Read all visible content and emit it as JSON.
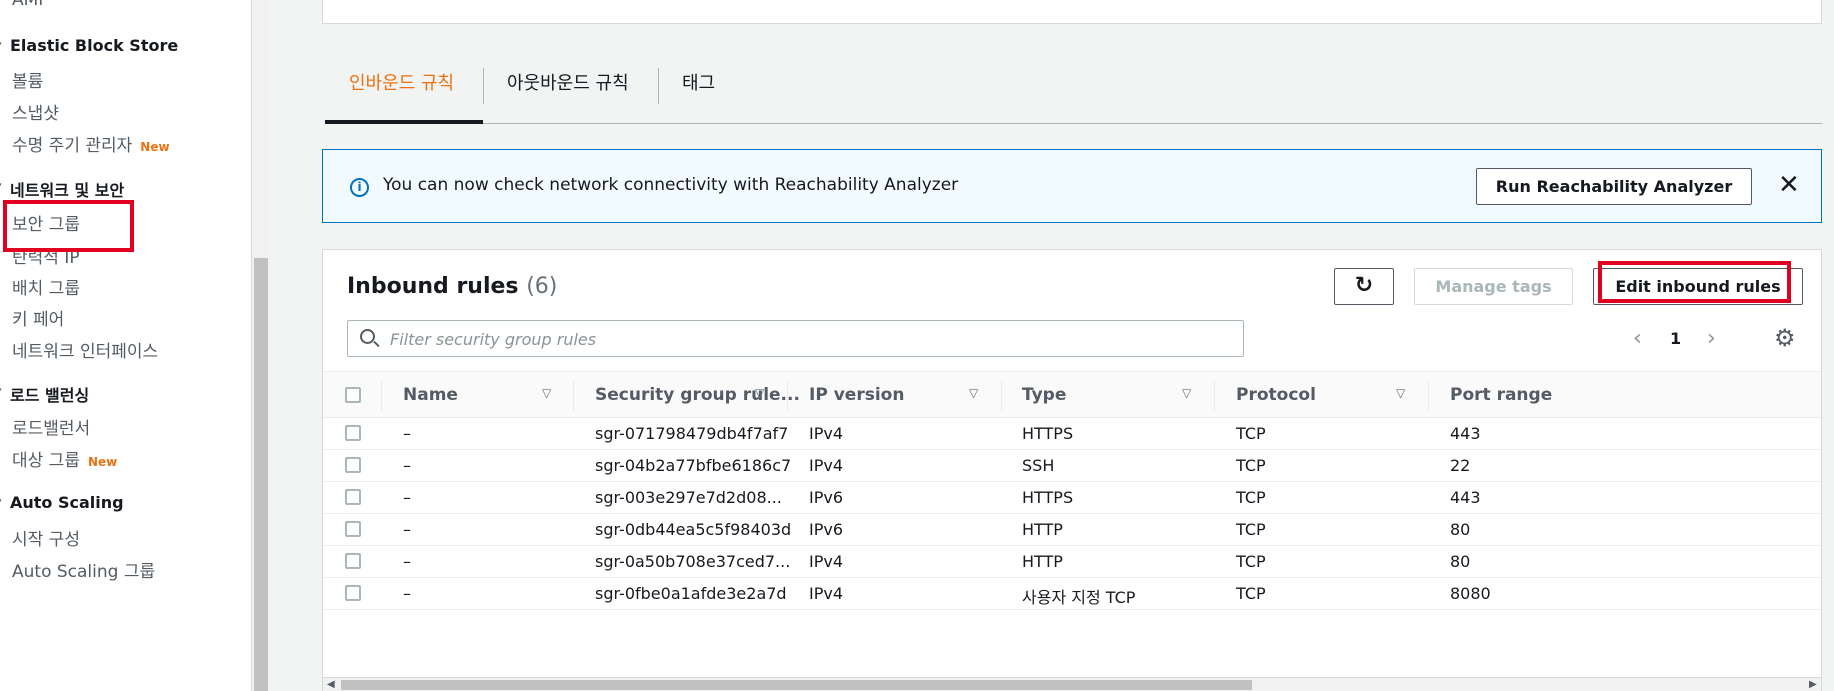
{
  "sidebar": {
    "cut_item": "AMI",
    "groups": [
      {
        "title": "Elastic Block Store",
        "items": [
          {
            "label": "볼륨"
          },
          {
            "label": "스냅샷"
          },
          {
            "label": "수명 주기 관리자",
            "badge": "New"
          }
        ]
      },
      {
        "title": "네트워크 및 보안",
        "items": [
          {
            "label": "보안 그룹"
          },
          {
            "label": "탄력적 IP"
          },
          {
            "label": "배치 그룹"
          },
          {
            "label": "키 페어"
          },
          {
            "label": "네트워크 인터페이스"
          }
        ]
      },
      {
        "title": "로드 밸런싱",
        "items": [
          {
            "label": "로드밸런서"
          },
          {
            "label": "대상 그룹",
            "badge": "New"
          }
        ]
      },
      {
        "title": "Auto Scaling",
        "items": [
          {
            "label": "시작 구성"
          },
          {
            "label": "Auto Scaling 그룹"
          }
        ]
      }
    ]
  },
  "tabs": [
    {
      "label": "인바운드 규칙",
      "active": true
    },
    {
      "label": "아웃바운드 규칙",
      "active": false
    },
    {
      "label": "태그",
      "active": false
    }
  ],
  "info_banner": {
    "message": "You can now check network connectivity with Reachability Analyzer",
    "button_label": "Run Reachability Analyzer",
    "close_icon": "✕"
  },
  "inbound": {
    "title": "Inbound rules",
    "count": "(6)",
    "refresh_icon": "↻",
    "manage_tags_label": "Manage tags",
    "edit_label": "Edit inbound rules",
    "search_placeholder": "Filter security group rules",
    "page": "1",
    "columns": [
      "Name",
      "Security group rule...",
      "IP version",
      "Type",
      "Protocol",
      "Port range"
    ],
    "rows": [
      {
        "name": "–",
        "rule_id": "sgr-071798479db4f7af7",
        "ip_version": "IPv4",
        "type": "HTTPS",
        "protocol": "TCP",
        "port_range": "443"
      },
      {
        "name": "–",
        "rule_id": "sgr-04b2a77bfbe6186c7",
        "ip_version": "IPv4",
        "type": "SSH",
        "protocol": "TCP",
        "port_range": "22"
      },
      {
        "name": "–",
        "rule_id": "sgr-003e297e7d2d08...",
        "ip_version": "IPv6",
        "type": "HTTPS",
        "protocol": "TCP",
        "port_range": "443"
      },
      {
        "name": "–",
        "rule_id": "sgr-0db44ea5c5f98403d",
        "ip_version": "IPv6",
        "type": "HTTP",
        "protocol": "TCP",
        "port_range": "80"
      },
      {
        "name": "–",
        "rule_id": "sgr-0a50b708e37ced7...",
        "ip_version": "IPv4",
        "type": "HTTP",
        "protocol": "TCP",
        "port_range": "80"
      },
      {
        "name": "–",
        "rule_id": "sgr-0fbe0a1afde3e2a7d",
        "ip_version": "IPv4",
        "type": "사용자 지정 TCP",
        "protocol": "TCP",
        "port_range": "8080"
      }
    ]
  },
  "colors": {
    "accent": "#ec7211",
    "info_border": "#0073bb",
    "highlight": "#e1001f"
  }
}
